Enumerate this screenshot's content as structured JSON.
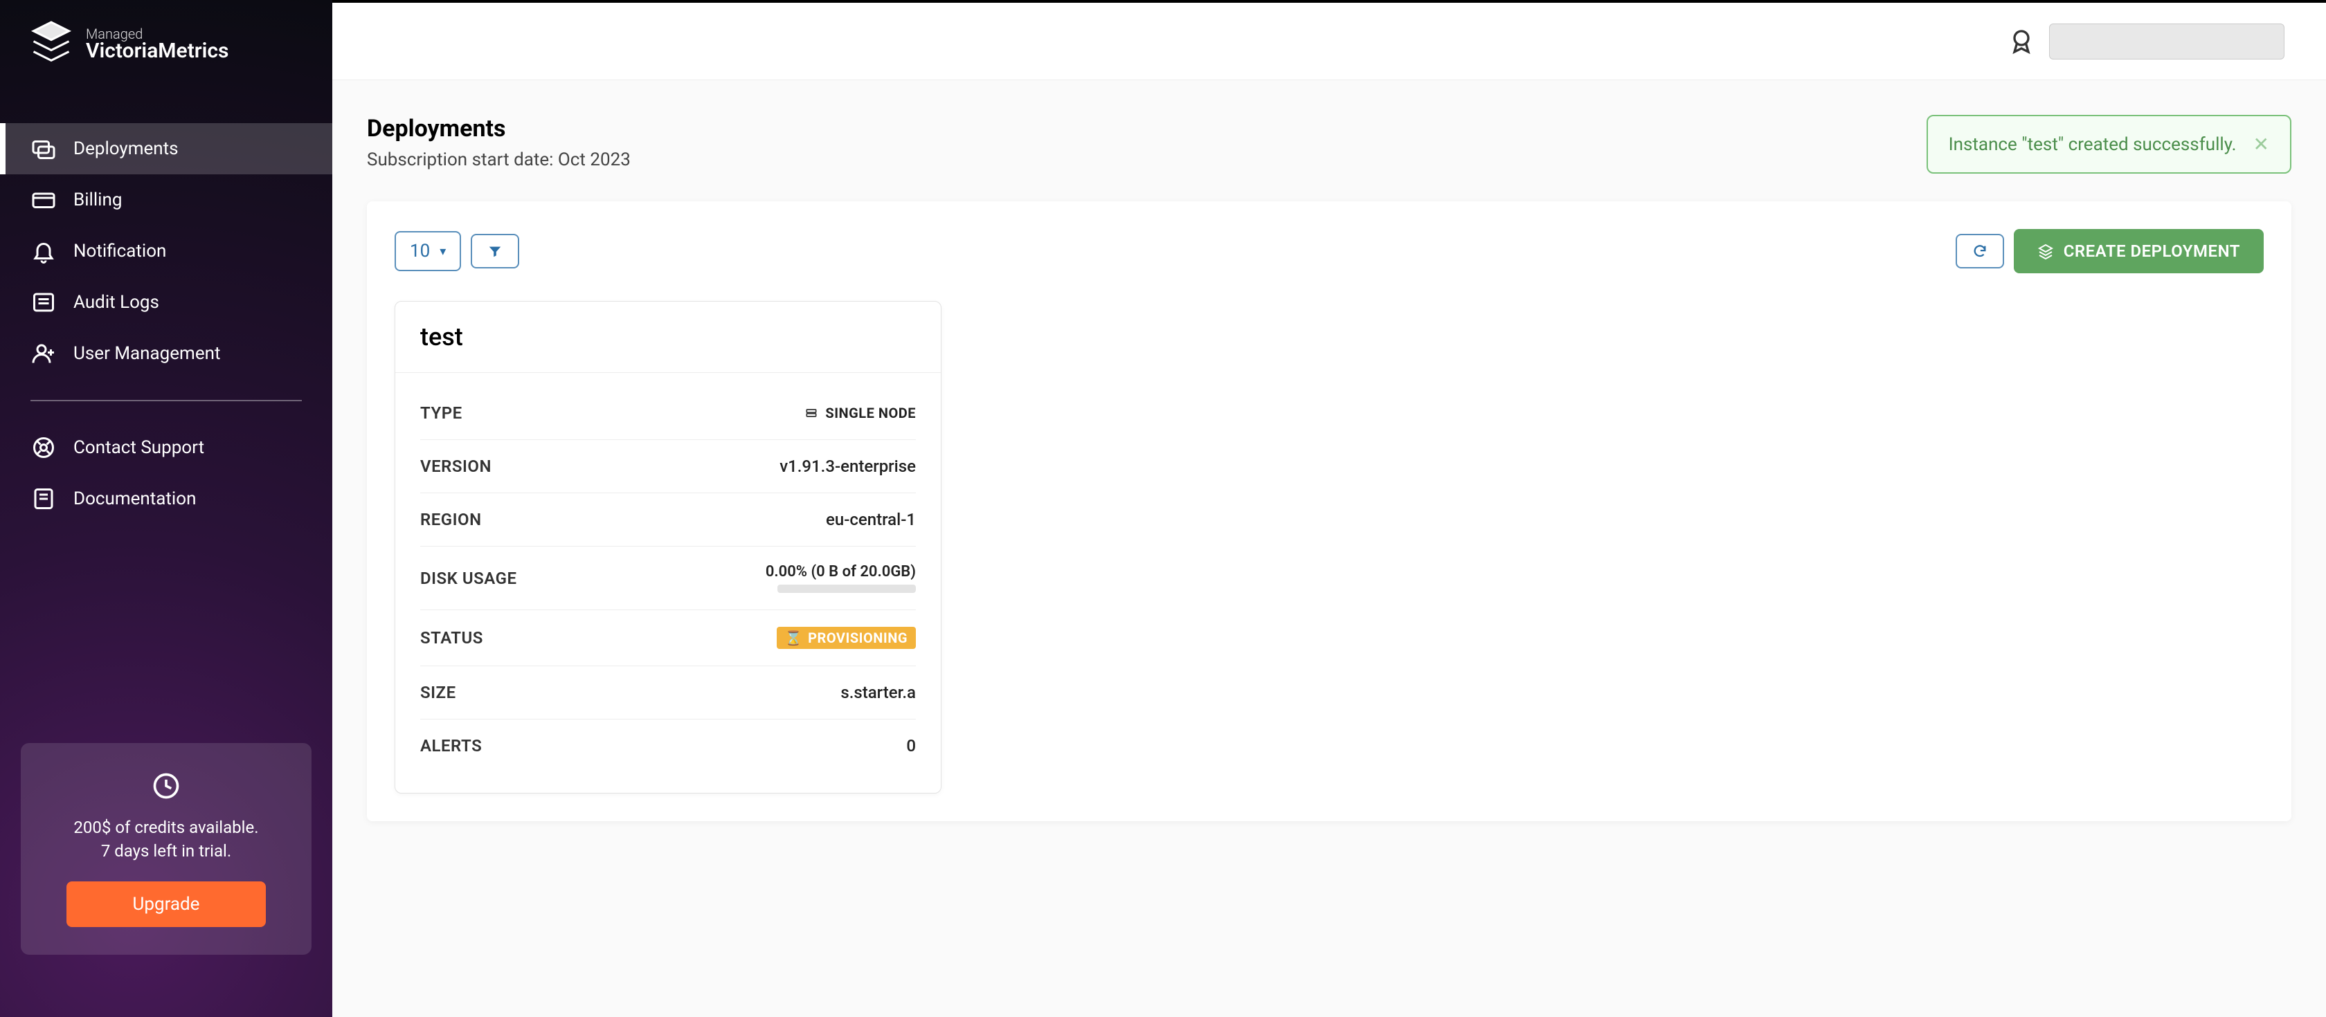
{
  "logo": {
    "line1": "Managed",
    "line2": "VictoriaMetrics"
  },
  "sidebar": {
    "items": [
      {
        "label": "Deployments",
        "active": true
      },
      {
        "label": "Billing"
      },
      {
        "label": "Notification"
      },
      {
        "label": "Audit Logs"
      },
      {
        "label": "User Management"
      }
    ],
    "secondary": [
      {
        "label": "Contact Support"
      },
      {
        "label": "Documentation"
      }
    ]
  },
  "trial": {
    "line1": "200$ of credits available.",
    "line2": "7 days left in trial.",
    "cta": "Upgrade"
  },
  "page": {
    "title": "Deployments",
    "subtitle": "Subscription start date: Oct 2023"
  },
  "alert": {
    "text": "Instance \"test\" created successfully."
  },
  "toolbar": {
    "page_size": "10",
    "create_label": "CREATE DEPLOYMENT"
  },
  "deployment": {
    "name": "test",
    "type_label": "TYPE",
    "type_value": "SINGLE NODE",
    "version_label": "VERSION",
    "version_value": "v1.91.3-enterprise",
    "region_label": "REGION",
    "region_value": "eu-central-1",
    "disk_label": "DISK USAGE",
    "disk_value": "0.00% (0 B of 20.0GB)",
    "status_label": "STATUS",
    "status_value": "PROVISIONING",
    "size_label": "SIZE",
    "size_value": "s.starter.a",
    "alerts_label": "ALERTS",
    "alerts_value": "0"
  }
}
